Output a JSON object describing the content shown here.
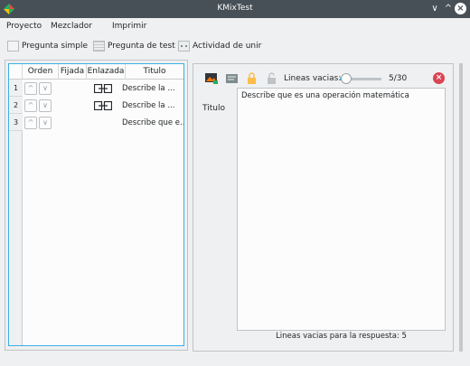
{
  "window": {
    "title": "KMixTest",
    "minimize_label": "∨",
    "maximize_label": "^",
    "close_label": "×"
  },
  "menu": {
    "items": [
      "Proyecto",
      "Mezclador",
      "Imprimir"
    ]
  },
  "toolbar": {
    "buttons": [
      {
        "label": "Pregunta simple",
        "icon": "simple-question-icon"
      },
      {
        "label": "Pregunta de test",
        "icon": "test-question-icon"
      },
      {
        "label": "Actividad de unir",
        "icon": "join-activity-icon"
      }
    ]
  },
  "table": {
    "headers": [
      "Orden",
      "Fijada",
      "Enlazada",
      "Titulo"
    ],
    "rows": [
      {
        "num": "1",
        "fixed": false,
        "linked": true,
        "titulo": "Describe la ..."
      },
      {
        "num": "2",
        "fixed": false,
        "linked": true,
        "titulo": "Describe la ..."
      },
      {
        "num": "3",
        "fixed": false,
        "linked": false,
        "titulo": "Describe que e..."
      }
    ],
    "up_arrow": "^",
    "down_arrow": "∨"
  },
  "editor": {
    "lineas_label": "Lineas vacias:",
    "lineas_value": "5/30",
    "lineas_current": 5,
    "lineas_max": 30,
    "titulo_label": "Titulo",
    "text": "Describe que es una operación matemática",
    "status": "Lineas vacias para la respuesta: 5",
    "remove_label": "×",
    "icons": [
      "image-icon",
      "text-icon",
      "lock-icon",
      "unlock-icon"
    ]
  },
  "colors": {
    "accent": "#3daee9",
    "titlebar": "#475057",
    "danger": "#da4453"
  }
}
